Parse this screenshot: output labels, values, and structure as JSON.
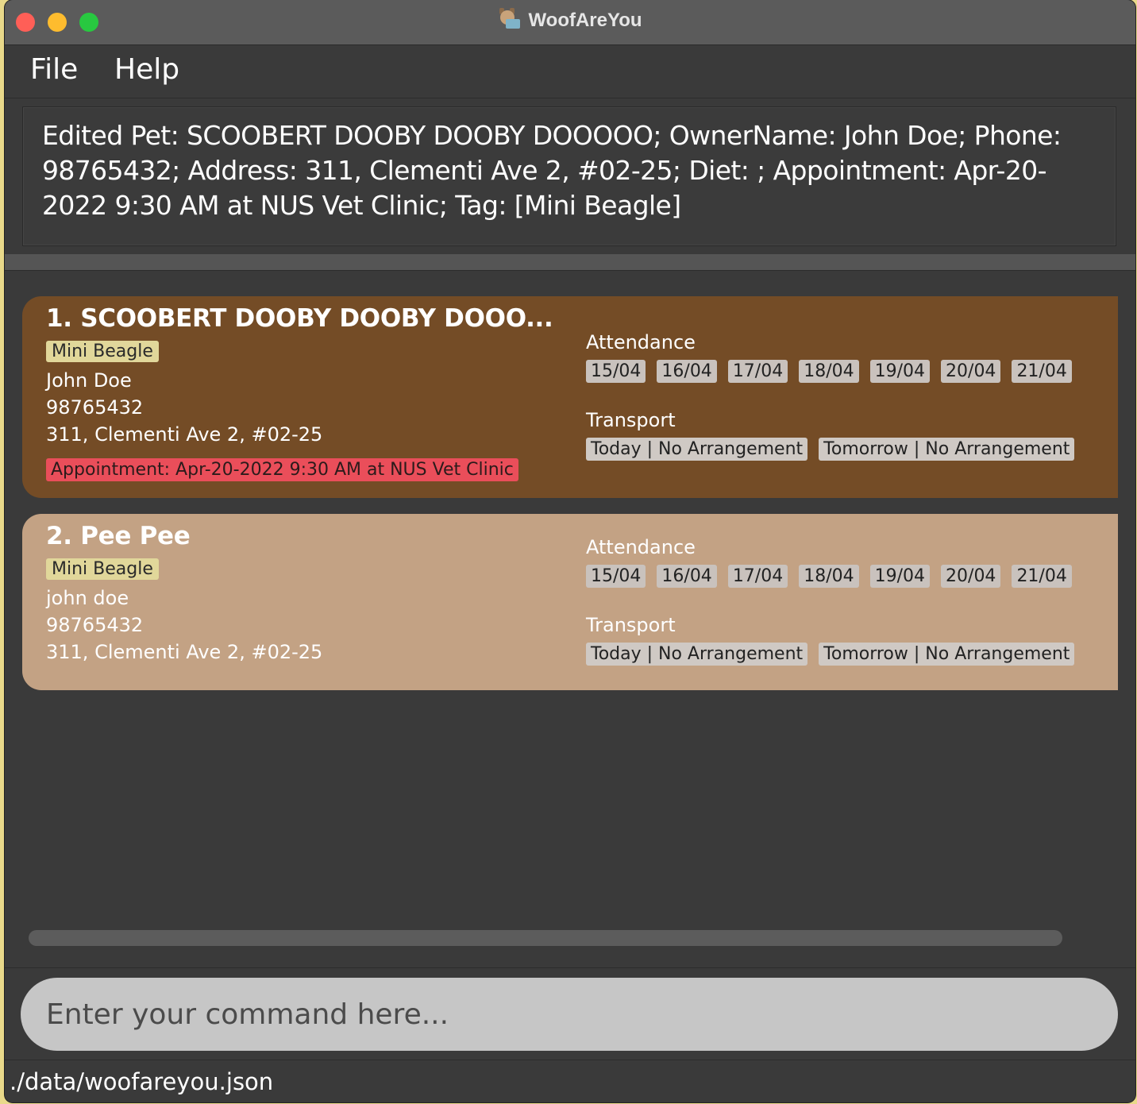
{
  "window": {
    "title": "WoofAreYou",
    "app_icon": "dog-with-laptop-icon"
  },
  "menu": {
    "file": "File",
    "help": "Help"
  },
  "result": {
    "text": "Edited Pet: SCOOBERT DOOBY DOOBY DOOOOO; OwnerName: John Doe; Phone: 98765432; Address: 311, Clementi Ave 2, #02-25; Diet: ; Appointment: Apr-20-2022 9:30 AM at NUS Vet Clinic; Tag: [Mini Beagle]"
  },
  "pets": [
    {
      "name": "1.  SCOOBERT DOOBY DOOBY DOOO...",
      "tag": "Mini Beagle",
      "owner": "John Doe",
      "phone": "98765432",
      "address": "311, Clementi Ave 2, #02-25",
      "appointment": "Appointment: Apr-20-2022 9:30 AM at NUS Vet Clinic",
      "attendance_label": "Attendance",
      "attendance": [
        "15/04",
        "16/04",
        "17/04",
        "18/04",
        "19/04",
        "20/04",
        "21/04"
      ],
      "transport_label": "Transport",
      "transport": [
        "Today | No Arrangement",
        "Tomorrow | No Arrangement"
      ],
      "card_color": "#744c26"
    },
    {
      "name": "2.  Pee Pee",
      "tag": "Mini Beagle",
      "owner": "john doe",
      "phone": "98765432",
      "address": "311, Clementi Ave 2, #02-25",
      "attendance_label": "Attendance",
      "attendance": [
        "15/04",
        "16/04",
        "17/04",
        "18/04",
        "19/04",
        "20/04",
        "21/04"
      ],
      "transport_label": "Transport",
      "transport": [
        "Today | No Arrangement",
        "Tomorrow | No Arrangement"
      ],
      "card_color": "#c3a284"
    }
  ],
  "command": {
    "placeholder": "Enter your command here..."
  },
  "status": {
    "file_path": "./data/woofareyou.json"
  }
}
